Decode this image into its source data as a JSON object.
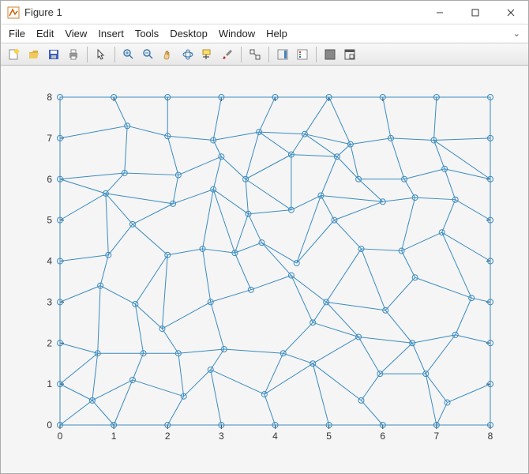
{
  "window": {
    "title": "Figure 1"
  },
  "menu": {
    "items": [
      "File",
      "Edit",
      "View",
      "Insert",
      "Tools",
      "Desktop",
      "Window",
      "Help"
    ]
  },
  "toolbar": {
    "groups": [
      [
        "new-figure-icon",
        "open-icon",
        "save-icon",
        "print-icon"
      ],
      [
        "pointer-icon"
      ],
      [
        "zoom-in-icon",
        "zoom-out-icon",
        "pan-icon",
        "rotate3d-icon",
        "data-cursor-icon",
        "brush-icon"
      ],
      [
        "link-plot-icon"
      ],
      [
        "colorbar-icon",
        "legend-icon"
      ],
      [
        "hide-tools-icon",
        "dock-icon"
      ]
    ]
  },
  "chart_data": {
    "type": "scatter",
    "title": "",
    "xlabel": "",
    "ylabel": "",
    "xlim": [
      0,
      8
    ],
    "ylim": [
      0,
      8
    ],
    "xticks": [
      0,
      1,
      2,
      3,
      4,
      5,
      6,
      7,
      8
    ],
    "yticks": [
      0,
      1,
      2,
      3,
      4,
      5,
      6,
      7,
      8
    ],
    "nodes": [
      [
        0,
        0
      ],
      [
        1,
        0
      ],
      [
        2,
        0
      ],
      [
        3,
        0
      ],
      [
        4,
        0
      ],
      [
        5,
        0
      ],
      [
        6,
        0
      ],
      [
        7,
        0
      ],
      [
        8,
        0
      ],
      [
        0,
        1
      ],
      [
        0.6,
        0.6
      ],
      [
        1.35,
        1.1
      ],
      [
        2.3,
        0.7
      ],
      [
        2.8,
        1.35
      ],
      [
        3.8,
        0.75
      ],
      [
        4.7,
        1.5
      ],
      [
        5.6,
        0.6
      ],
      [
        5.95,
        1.25
      ],
      [
        6.8,
        1.25
      ],
      [
        7.2,
        0.55
      ],
      [
        8,
        1
      ],
      [
        0,
        2
      ],
      [
        0.7,
        1.75
      ],
      [
        1.55,
        1.75
      ],
      [
        2.2,
        1.75
      ],
      [
        3.05,
        1.85
      ],
      [
        4.15,
        1.75
      ],
      [
        4.7,
        2.5
      ],
      [
        5.55,
        2.15
      ],
      [
        6.55,
        2.0
      ],
      [
        7.35,
        2.2
      ],
      [
        8,
        2
      ],
      [
        0,
        3
      ],
      [
        0.75,
        3.4
      ],
      [
        1.4,
        2.95
      ],
      [
        1.9,
        2.35
      ],
      [
        2.8,
        3.0
      ],
      [
        3.55,
        3.3
      ],
      [
        4.3,
        3.65
      ],
      [
        4.95,
        3.0
      ],
      [
        6.05,
        2.8
      ],
      [
        6.6,
        3.6
      ],
      [
        7.65,
        3.1
      ],
      [
        8,
        3
      ],
      [
        0,
        4
      ],
      [
        0.9,
        4.15
      ],
      [
        1.35,
        4.9
      ],
      [
        2.0,
        4.15
      ],
      [
        2.65,
        4.3
      ],
      [
        3.25,
        4.2
      ],
      [
        3.75,
        4.45
      ],
      [
        4.4,
        3.95
      ],
      [
        5.1,
        5.0
      ],
      [
        5.6,
        4.3
      ],
      [
        6.35,
        4.25
      ],
      [
        7.1,
        4.7
      ],
      [
        8,
        4
      ],
      [
        0,
        5
      ],
      [
        0.85,
        5.65
      ],
      [
        2.1,
        5.4
      ],
      [
        2.85,
        5.75
      ],
      [
        3.5,
        5.15
      ],
      [
        4.3,
        5.25
      ],
      [
        4.85,
        5.6
      ],
      [
        6.0,
        5.45
      ],
      [
        6.6,
        5.55
      ],
      [
        7.35,
        5.5
      ],
      [
        8,
        5
      ],
      [
        0,
        6
      ],
      [
        1.2,
        6.15
      ],
      [
        2.2,
        6.1
      ],
      [
        3.0,
        6.55
      ],
      [
        3.45,
        6.0
      ],
      [
        4.3,
        6.6
      ],
      [
        5.15,
        6.55
      ],
      [
        5.55,
        6.0
      ],
      [
        6.4,
        6.0
      ],
      [
        7.15,
        6.25
      ],
      [
        8,
        6
      ],
      [
        0,
        7
      ],
      [
        1.25,
        7.3
      ],
      [
        2.0,
        7.05
      ],
      [
        2.85,
        6.95
      ],
      [
        3.7,
        7.15
      ],
      [
        4.55,
        7.1
      ],
      [
        5.4,
        6.85
      ],
      [
        6.15,
        7.0
      ],
      [
        6.95,
        6.95
      ],
      [
        8,
        7
      ],
      [
        0,
        8
      ],
      [
        1,
        8
      ],
      [
        2,
        8
      ],
      [
        3,
        8
      ],
      [
        4,
        8
      ],
      [
        5,
        8
      ],
      [
        6,
        8
      ],
      [
        7,
        8
      ],
      [
        8,
        8
      ]
    ],
    "edges": [
      [
        0,
        1
      ],
      [
        1,
        2
      ],
      [
        2,
        3
      ],
      [
        3,
        4
      ],
      [
        4,
        5
      ],
      [
        5,
        6
      ],
      [
        6,
        7
      ],
      [
        7,
        8
      ],
      [
        0,
        10
      ],
      [
        10,
        1
      ],
      [
        10,
        11
      ],
      [
        1,
        11
      ],
      [
        11,
        12
      ],
      [
        12,
        2
      ],
      [
        12,
        13
      ],
      [
        13,
        3
      ],
      [
        13,
        14
      ],
      [
        14,
        4
      ],
      [
        14,
        15
      ],
      [
        15,
        5
      ],
      [
        15,
        16
      ],
      [
        16,
        6
      ],
      [
        16,
        17
      ],
      [
        17,
        18
      ],
      [
        18,
        7
      ],
      [
        18,
        19
      ],
      [
        19,
        7
      ],
      [
        19,
        20
      ],
      [
        20,
        8
      ],
      [
        0,
        9
      ],
      [
        9,
        10
      ],
      [
        9,
        22
      ],
      [
        10,
        22
      ],
      [
        11,
        23
      ],
      [
        22,
        23
      ],
      [
        23,
        24
      ],
      [
        12,
        24
      ],
      [
        24,
        25
      ],
      [
        13,
        25
      ],
      [
        25,
        26
      ],
      [
        14,
        26
      ],
      [
        26,
        15
      ],
      [
        26,
        27
      ],
      [
        27,
        28
      ],
      [
        15,
        28
      ],
      [
        17,
        28
      ],
      [
        28,
        29
      ],
      [
        17,
        29
      ],
      [
        18,
        29
      ],
      [
        29,
        30
      ],
      [
        18,
        30
      ],
      [
        30,
        31
      ],
      [
        20,
        31
      ],
      [
        9,
        21
      ],
      [
        21,
        22
      ],
      [
        21,
        32
      ],
      [
        22,
        33
      ],
      [
        33,
        34
      ],
      [
        23,
        34
      ],
      [
        34,
        35
      ],
      [
        24,
        35
      ],
      [
        35,
        36
      ],
      [
        25,
        36
      ],
      [
        36,
        37
      ],
      [
        37,
        38
      ],
      [
        27,
        38
      ],
      [
        27,
        39
      ],
      [
        38,
        39
      ],
      [
        28,
        39
      ],
      [
        39,
        40
      ],
      [
        29,
        40
      ],
      [
        40,
        41
      ],
      [
        41,
        42
      ],
      [
        30,
        42
      ],
      [
        42,
        43
      ],
      [
        31,
        43
      ],
      [
        21,
        44
      ],
      [
        32,
        44
      ],
      [
        32,
        33
      ],
      [
        33,
        45
      ],
      [
        44,
        45
      ],
      [
        45,
        46
      ],
      [
        34,
        47
      ],
      [
        46,
        47
      ],
      [
        35,
        47
      ],
      [
        47,
        48
      ],
      [
        36,
        48
      ],
      [
        48,
        49
      ],
      [
        37,
        49
      ],
      [
        49,
        50
      ],
      [
        38,
        50
      ],
      [
        50,
        51
      ],
      [
        51,
        52
      ],
      [
        39,
        53
      ],
      [
        52,
        53
      ],
      [
        40,
        53
      ],
      [
        53,
        54
      ],
      [
        41,
        54
      ],
      [
        54,
        55
      ],
      [
        42,
        55
      ],
      [
        55,
        56
      ],
      [
        43,
        56
      ],
      [
        44,
        57
      ],
      [
        45,
        58
      ],
      [
        46,
        58
      ],
      [
        57,
        58
      ],
      [
        46,
        59
      ],
      [
        58,
        59
      ],
      [
        48,
        60
      ],
      [
        59,
        60
      ],
      [
        49,
        60
      ],
      [
        60,
        61
      ],
      [
        49,
        61
      ],
      [
        50,
        61
      ],
      [
        61,
        62
      ],
      [
        62,
        63
      ],
      [
        51,
        63
      ],
      [
        52,
        63
      ],
      [
        52,
        64
      ],
      [
        63,
        64
      ],
      [
        64,
        75
      ],
      [
        54,
        65
      ],
      [
        64,
        65
      ],
      [
        65,
        66
      ],
      [
        55,
        66
      ],
      [
        66,
        67
      ],
      [
        56,
        67
      ],
      [
        57,
        68
      ],
      [
        58,
        68
      ],
      [
        58,
        69
      ],
      [
        68,
        69
      ],
      [
        69,
        70
      ],
      [
        59,
        70
      ],
      [
        70,
        71
      ],
      [
        60,
        71
      ],
      [
        71,
        72
      ],
      [
        61,
        72
      ],
      [
        62,
        72
      ],
      [
        72,
        73
      ],
      [
        62,
        73
      ],
      [
        73,
        74
      ],
      [
        63,
        74
      ],
      [
        74,
        75
      ],
      [
        75,
        76
      ],
      [
        65,
        76
      ],
      [
        76,
        77
      ],
      [
        66,
        77
      ],
      [
        77,
        78
      ],
      [
        67,
        78
      ],
      [
        68,
        79
      ],
      [
        79,
        80
      ],
      [
        69,
        80
      ],
      [
        80,
        81
      ],
      [
        70,
        81
      ],
      [
        81,
        82
      ],
      [
        71,
        82
      ],
      [
        82,
        83
      ],
      [
        72,
        83
      ],
      [
        73,
        83
      ],
      [
        83,
        84
      ],
      [
        73,
        84
      ],
      [
        74,
        84
      ],
      [
        84,
        85
      ],
      [
        74,
        85
      ],
      [
        75,
        85
      ],
      [
        85,
        86
      ],
      [
        76,
        86
      ],
      [
        86,
        87
      ],
      [
        77,
        87
      ],
      [
        78,
        87
      ],
      [
        78,
        88
      ],
      [
        87,
        88
      ],
      [
        79,
        89
      ],
      [
        80,
        90
      ],
      [
        89,
        90
      ],
      [
        81,
        91
      ],
      [
        90,
        91
      ],
      [
        82,
        92
      ],
      [
        91,
        92
      ],
      [
        83,
        93
      ],
      [
        92,
        93
      ],
      [
        84,
        94
      ],
      [
        93,
        94
      ],
      [
        85,
        94
      ],
      [
        94,
        95
      ],
      [
        86,
        95
      ],
      [
        95,
        96
      ],
      [
        87,
        96
      ],
      [
        96,
        97
      ],
      [
        88,
        97
      ],
      [
        79,
        68
      ]
    ]
  }
}
